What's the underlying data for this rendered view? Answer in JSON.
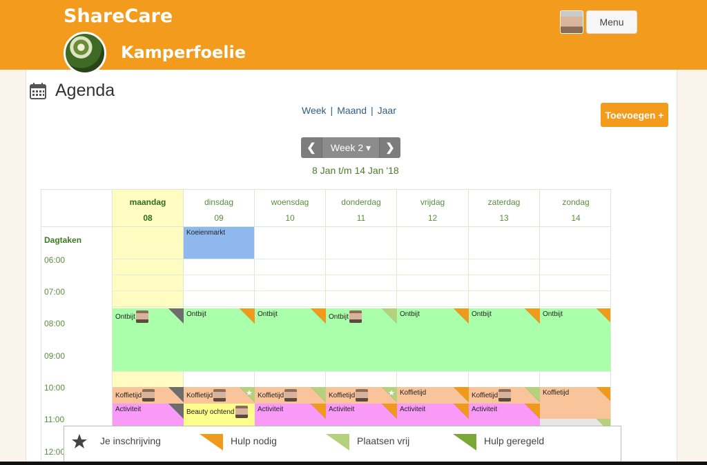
{
  "app": {
    "name": "ShareCare",
    "group": "Kamperfoelie",
    "menu_label": "Menu"
  },
  "page": {
    "title": "Agenda",
    "add_label": "Toevoegen +"
  },
  "views": [
    {
      "label": "Week",
      "sep": "|"
    },
    {
      "label": "Maand",
      "sep": "|"
    },
    {
      "label": "Jaar",
      "sep": ""
    }
  ],
  "week": {
    "prev": "❮",
    "label": "Week 2 ▾",
    "next": "❯",
    "range": "8 Jan t/m 14 Jan '18"
  },
  "days": [
    {
      "name": "maandag",
      "date": "08"
    },
    {
      "name": "dinsdag",
      "date": "09"
    },
    {
      "name": "woensdag",
      "date": "10"
    },
    {
      "name": "donderdag",
      "date": "11"
    },
    {
      "name": "vrijdag",
      "date": "12"
    },
    {
      "name": "zaterdag",
      "date": "13"
    },
    {
      "name": "zondag",
      "date": "14"
    }
  ],
  "dagtaken_label": "Dagtaken",
  "times": [
    "06:00",
    "07:00",
    "08:00",
    "09:00",
    "10:00",
    "11:00",
    "12:00"
  ],
  "events": {
    "koeienmarkt": "Koeienmarkt",
    "ontbijt": [
      "Ontbijt",
      "Ontbijt",
      "Ontbijt",
      "Ontbijt",
      "Ontbijt",
      "Ontbijt",
      "Ontbijt"
    ],
    "koffietijd": [
      "Koffietijd",
      "Koffietijd",
      "Koffietijd",
      "Koffietijd",
      "Koffietijd",
      "Koffietijd",
      "Koffietijd"
    ],
    "activiteit": [
      "Activiteit",
      "Beauty ochtend",
      "Activiteit",
      "Activiteit",
      "Activiteit",
      "Activiteit"
    ]
  },
  "legend": [
    "Je inschrijving",
    "Hulp nodig",
    "Plaatsen vrij",
    "Hulp geregeld"
  ],
  "colors": {
    "orange": "#f29b1d",
    "green_event": "#aaffaa",
    "pink_event": "#f99af9",
    "peach_event": "#f9c49a",
    "blue_event": "#8fb8ee",
    "yellow_today": "#fefcc0",
    "hulp_nodig": "#f09a1c",
    "plaatsen_vrij": "#b4d17e",
    "hulp_geregeld": "#7aa838"
  }
}
